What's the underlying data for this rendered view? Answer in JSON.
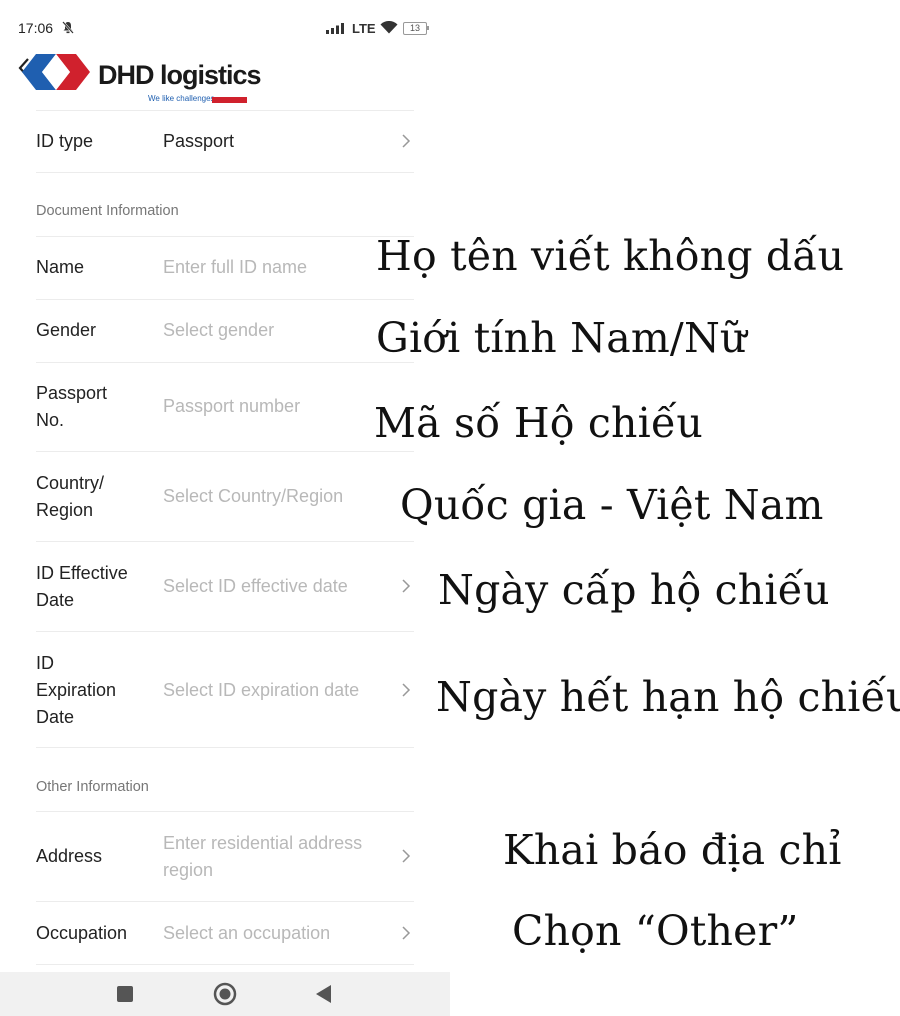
{
  "status_bar": {
    "time": "17:06",
    "network": "LTE",
    "battery": "13"
  },
  "brand": {
    "name": "DHD logistics",
    "tagline": "We like challenges"
  },
  "colors": {
    "logo_red": "#d0212d",
    "logo_blue": "#1f5fb0",
    "placeholder": "#b8b8b8",
    "label": "#222222",
    "section": "#777777"
  },
  "form": {
    "id_type": {
      "label": "ID type",
      "value": "Passport"
    },
    "section_document": "Document Information",
    "name": {
      "label": "Name",
      "placeholder": "Enter full ID name"
    },
    "gender": {
      "label": "Gender",
      "placeholder": "Select gender"
    },
    "passport": {
      "label_line1": "Passport",
      "label_line2": "No.",
      "placeholder": "Passport number"
    },
    "country": {
      "label_line1": "Country/",
      "label_line2": "Region",
      "placeholder": "Select Country/Region"
    },
    "effective": {
      "label_line1": "ID Effective",
      "label_line2": "Date",
      "placeholder": "Select ID effective date"
    },
    "expiration": {
      "label_line1": "ID",
      "label_line2": "Expiration",
      "label_line3": "Date",
      "placeholder": "Select ID expiration date"
    },
    "section_other": "Other Information",
    "address": {
      "label": "Address",
      "placeholder_line1": "Enter residential address",
      "placeholder_line2": "region"
    },
    "occupation": {
      "label": "Occupation",
      "placeholder": "Select an occupation"
    }
  },
  "annotations": {
    "name": "Họ tên viết không dấu",
    "gender": "Giới tính Nam/Nữ",
    "passport": "Mã số Hộ chiếu",
    "country": "Quốc gia - Việt Nam",
    "effective": "Ngày cấp hộ chiếu",
    "expiration": "Ngày hết hạn hộ chiếu",
    "address": "Khai báo địa chỉ",
    "occupation": "Chọn “Other”"
  }
}
